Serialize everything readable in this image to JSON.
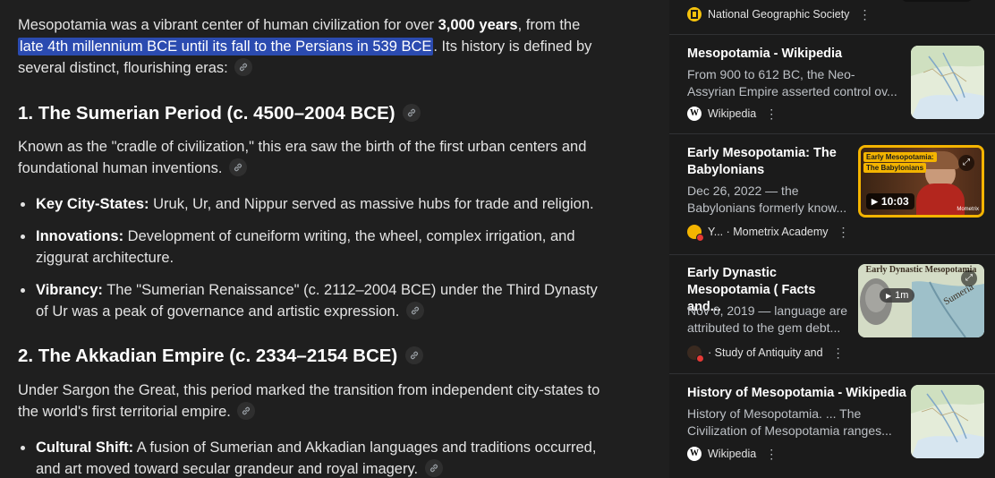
{
  "article": {
    "intro_pre": "Mesopotamia was a vibrant center of human civilization for over ",
    "intro_bold": "3,000 years",
    "intro_mid": ", from the ",
    "intro_highlight": "late 4th millennium BCE until its fall to the Persians in 539 BCE",
    "intro_post": ". Its history is defined by several distinct, flourishing eras:",
    "sections": [
      {
        "heading": "1. The Sumerian Period (c. 4500–2004 BCE)",
        "description": "Known as the \"cradle of civilization,\" this era saw the birth of the first urban centers and foundational human inventions.",
        "bullets": [
          {
            "label": "Key City-States:",
            "text": " Uruk, Ur, and Nippur served as massive hubs for trade and religion."
          },
          {
            "label": "Innovations:",
            "text": " Development of cuneiform writing, the wheel, complex irrigation, and ziggurat architecture."
          },
          {
            "label": "Vibrancy:",
            "text": " The \"Sumerian Renaissance\" (c. 2112–2004 BCE) under the Third Dynasty of Ur was a peak of governance and artistic expression."
          }
        ]
      },
      {
        "heading": "2. The Akkadian Empire (c. 2334–2154 BCE)",
        "description": "Under Sargon the Great, this period marked the transition from independent city-states to the world's first territorial empire.",
        "bullets": [
          {
            "label": "Cultural Shift:",
            "text": " A fusion of Sumerian and Akkadian languages and traditions occurred, and art moved toward secular grandeur and royal imagery."
          }
        ]
      }
    ]
  },
  "sidebar": {
    "top_source": "National Geographic Society",
    "results": [
      {
        "title": "Mesopotamia - Wikipedia",
        "snippet": "From 900 to 612 BC, the Neo-Assyrian Empire asserted control ov...",
        "source": "Wikipedia",
        "thumb": "map"
      },
      {
        "title": "Early Mesopotamia: The Babylonians",
        "snippet": "Dec 26, 2022 — the Babylonians formerly know...",
        "source": "Y... · Mometrix Academy",
        "thumb": "video",
        "duration": "10:03",
        "thumb_caption_1": "Early Mesopotamia:",
        "thumb_caption_2": "The Babylonians",
        "thumb_brand": "Mometrix"
      },
      {
        "title": "Early Dynastic Mesopotamia ( Facts and...",
        "snippet": "Nov 6, 2019 — language are attributed to the gem debt...",
        "source": "· Study of Antiquity and",
        "thumb": "short",
        "duration": "1m",
        "thumb_caption": "Early Dynastic Mesopotamia",
        "thumb_map_label": "Sumeria"
      },
      {
        "title": "History of Mesopotamia - Wikipedia",
        "snippet": "History of Mesopotamia. ... The Civilization of Mesopotamia ranges...",
        "source": "Wikipedia",
        "thumb": "map"
      }
    ]
  },
  "colors": {
    "highlight": "#2b4bb0",
    "background": "#1f1f1f",
    "sidebar": "#1b1b1b",
    "thumb_video_border": "#f4b400"
  }
}
